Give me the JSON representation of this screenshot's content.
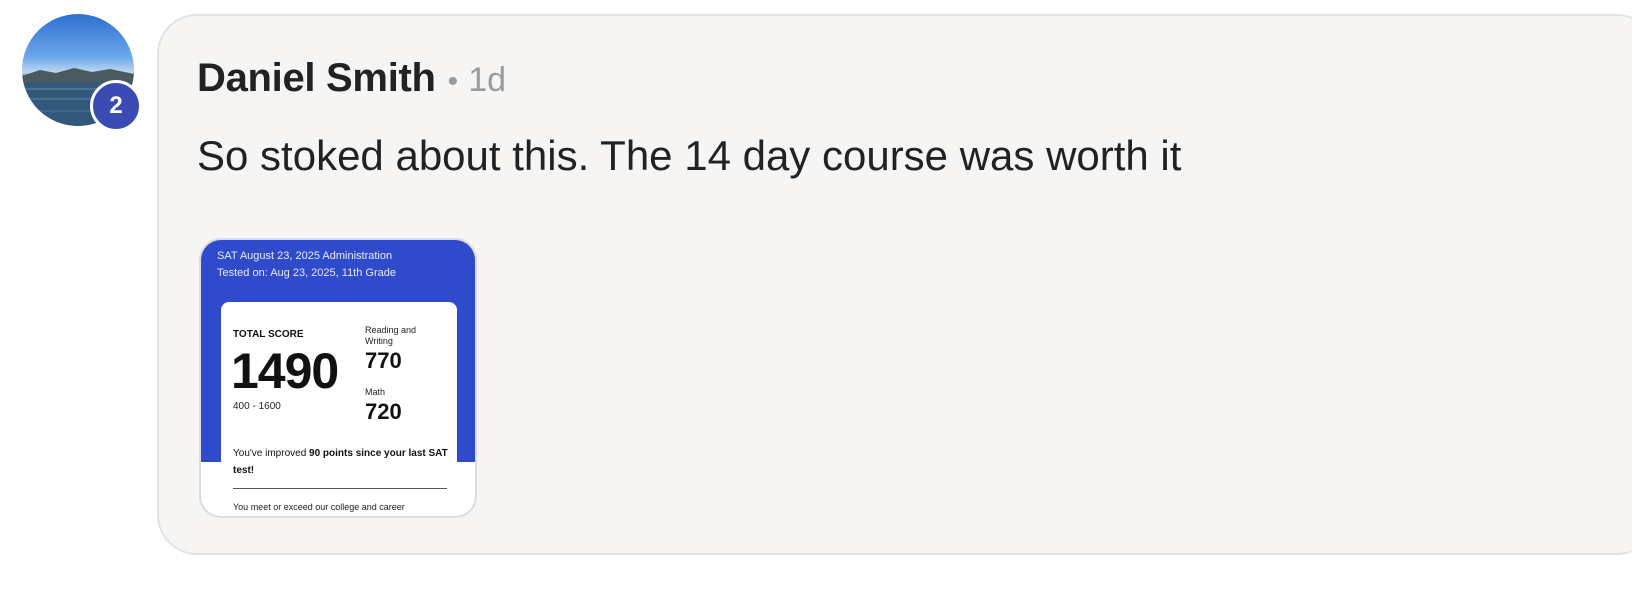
{
  "comment": {
    "avatar_badge": "2",
    "author": "Daniel Smith",
    "separator": "•",
    "time": "1d",
    "text": "So stoked about this. The 14 day course was worth it"
  },
  "attachment": {
    "header_line1": "SAT August 23, 2025 Administration",
    "header_line2": "Tested on: Aug 23, 2025, 11th Grade",
    "total_label": "TOTAL SCORE",
    "total_score": "1490",
    "score_range": "400 - 1600",
    "rw_label": "Reading and Writing",
    "rw_score": "770",
    "math_label": "Math",
    "math_score": "720",
    "improve_prefix": "You've improved ",
    "improve_bold": "90 points since your last SAT test!",
    "meet_text": "You meet or exceed our college and career"
  },
  "colors": {
    "badge": "#3a4cb3",
    "card_blue": "#2f4bcb",
    "bubble_bg": "#f6f5f3"
  }
}
